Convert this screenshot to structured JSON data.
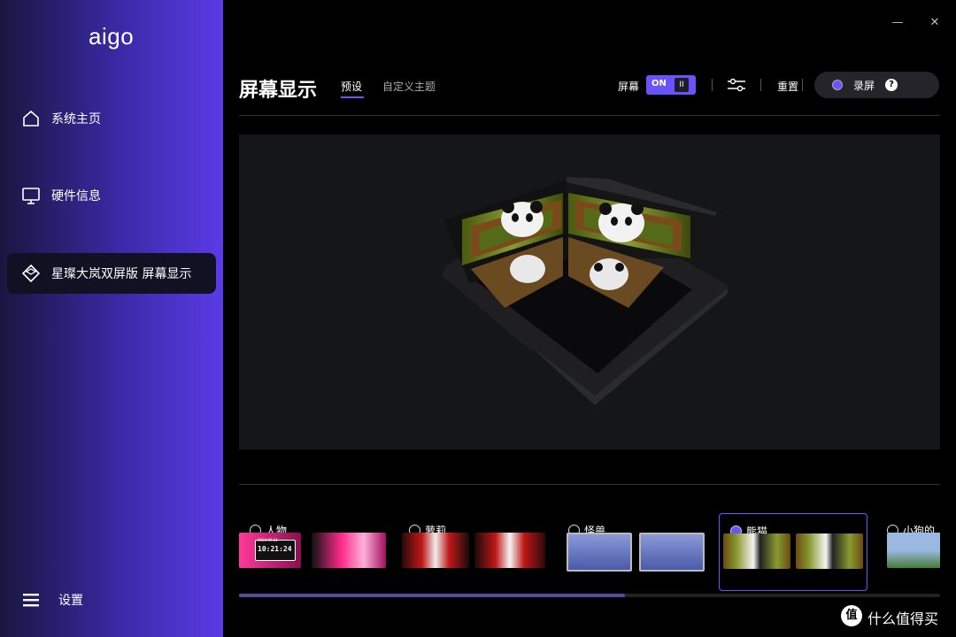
{
  "app": {
    "logo": "aigo"
  },
  "sidebar": {
    "items": [
      {
        "label": "系统主页",
        "icon": "home-icon"
      },
      {
        "label": "硬件信息",
        "icon": "monitor-icon"
      },
      {
        "label": "星璨大岚双屏版 屏幕显示",
        "icon": "cube-icon",
        "active": true
      }
    ],
    "settings": {
      "label": "设置",
      "icon": "menu-icon"
    }
  },
  "window": {
    "minimize": "—",
    "close": "✕"
  },
  "header": {
    "title": "屏幕显示",
    "tabs": [
      {
        "label": "预设",
        "active": true
      },
      {
        "label": "自定义主题",
        "active": false
      }
    ],
    "screen_label": "屏幕",
    "toggle_state": "ON",
    "pause_icon": "II",
    "reset_label": "重置",
    "record_label": "录屏",
    "help_label": "?"
  },
  "themes": [
    {
      "name": "人物",
      "selected": false
    },
    {
      "name": "萝莉",
      "selected": false
    },
    {
      "name": "怪兽",
      "selected": false
    },
    {
      "name": "熊猫",
      "selected": true
    },
    {
      "name": "小狗的",
      "selected": false
    }
  ],
  "scrollbar": {
    "position_fraction": 0.55
  },
  "thumb_text": {
    "clock": "10:21:24",
    "date": "2024.09.21"
  },
  "watermark": {
    "badge": "值",
    "text": "什么值得买"
  },
  "colors": {
    "accent": "#6b52ff",
    "sidebar_start": "#1a1640",
    "sidebar_end": "#5a3be6"
  }
}
